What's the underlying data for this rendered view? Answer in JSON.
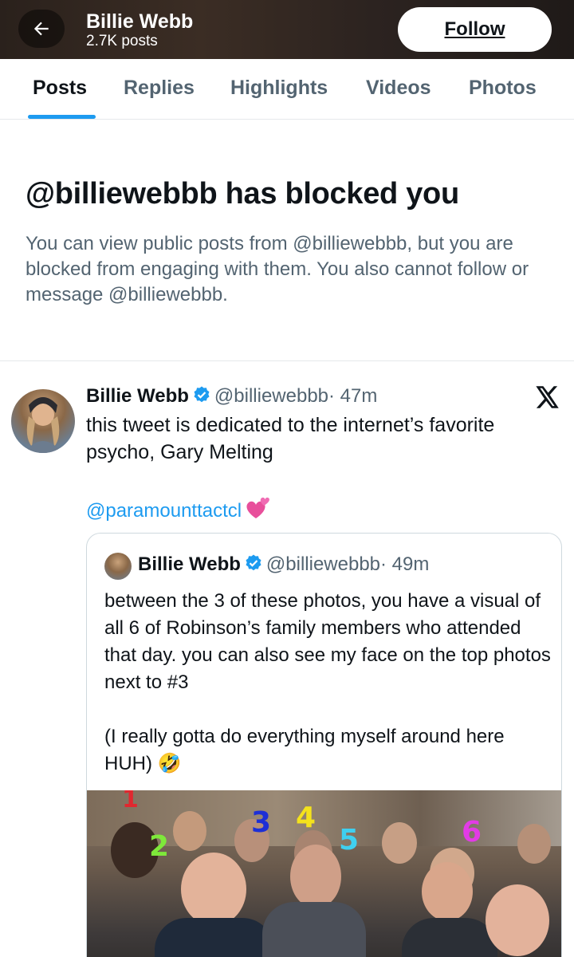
{
  "header": {
    "title": "Billie Webb",
    "subtitle": "2.7K posts",
    "follow_label": "Follow"
  },
  "tabs": [
    {
      "label": "Posts",
      "active": true
    },
    {
      "label": "Replies",
      "active": false
    },
    {
      "label": "Highlights",
      "active": false
    },
    {
      "label": "Videos",
      "active": false
    },
    {
      "label": "Photos",
      "active": false
    }
  ],
  "block_notice": {
    "title": "@billiewebbb has blocked you",
    "description": "You can view public posts from @billiewebbb, but you are blocked from engaging with them. You also cannot follow or message @billiewebbb."
  },
  "tweet": {
    "name": "Billie Webb",
    "handle": "@billiewebbb",
    "time": "· 47m",
    "text": "this tweet is dedicated to the internet’s favorite psycho, Gary Melting",
    "mention": "@paramounttactcl",
    "quoted": {
      "name": "Billie Webb",
      "handle": "@billiewebbb",
      "time": "· 49m",
      "text_1": "between the 3 of these photos, you have a visual of all 6 of Robinson’s family members who attended that day. you can also see my face on the top photos next to #3",
      "text_2": "(I really gotta do everything myself around here HUH) 🤣",
      "photo_marks": [
        "1",
        "2",
        "3",
        "4",
        "5",
        "6"
      ]
    }
  },
  "icons": {
    "back": "arrow-left-icon",
    "verified": "verified-badge-icon",
    "x_logo": "x-logo-icon",
    "heart": "two-hearts-icon"
  },
  "colors": {
    "accent": "#1d9bf0",
    "text": "#0f1419",
    "muted": "#536471",
    "mark_colors": [
      "#e0282f",
      "#7ee83a",
      "#1d2fd6",
      "#f4e21c",
      "#3fd0f0",
      "#e23be6"
    ]
  }
}
